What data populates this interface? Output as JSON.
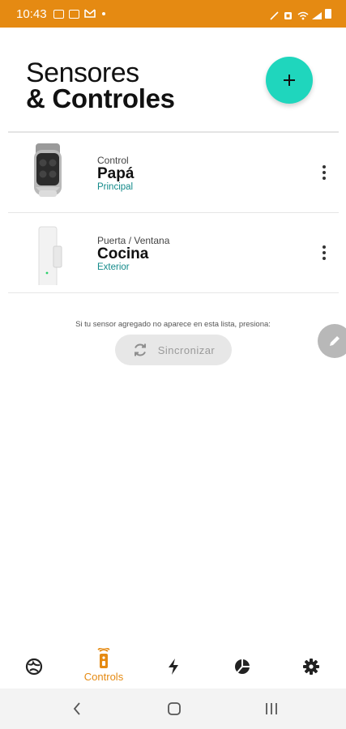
{
  "status_bar": {
    "time": "10:43",
    "left_icons": [
      "chat-icon",
      "image-icon",
      "gmail-icon",
      "dot-icon"
    ],
    "right_icons": [
      "mute-icon",
      "nfc-icon",
      "wifi-icon",
      "signal-icon",
      "battery-icon"
    ]
  },
  "header": {
    "title_line1": "Sensores",
    "title_line2": "& Controles",
    "add_button_icon": "plus-icon"
  },
  "devices": [
    {
      "type": "Control",
      "name": "Papá",
      "location": "Principal",
      "image": "remote-control"
    },
    {
      "type": "Puerta / Ventana",
      "name": "Cocina",
      "location": "Exterior",
      "image": "door-sensor"
    }
  ],
  "sync": {
    "hint": "Si tu sensor agregado no aparece en esta lista, presiona:",
    "button_label": "Sincronizar",
    "icon": "sync-icon"
  },
  "edit_button_icon": "pencil-icon",
  "bottom_nav": {
    "active": "Controls",
    "items": [
      {
        "icon": "globe-icon",
        "label": ""
      },
      {
        "icon": "remote-icon",
        "label": "Controls"
      },
      {
        "icon": "bolt-icon",
        "label": ""
      },
      {
        "icon": "pie-chart-icon",
        "label": ""
      },
      {
        "icon": "gear-icon",
        "label": ""
      }
    ]
  },
  "colors": {
    "status_bar": "#e58a12",
    "accent": "#1fd6bd",
    "location_text": "#138a8a",
    "nav_active": "#e58a12"
  }
}
